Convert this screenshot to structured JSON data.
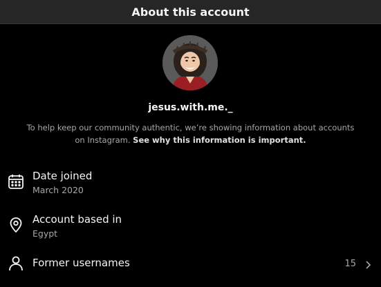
{
  "header": {
    "title": "About this account"
  },
  "profile": {
    "username": "jesus.with.me._"
  },
  "description": {
    "text": "To help keep our community authentic, we’re showing information about accounts on Instagram.",
    "link": "See why this information is important."
  },
  "rows": [
    {
      "label": "Date joined",
      "value": "March 2020",
      "icon": "calendar-icon"
    },
    {
      "label": "Account based in",
      "value": "Egypt",
      "icon": "location-pin-icon"
    },
    {
      "label": "Former usernames",
      "count": "15",
      "icon": "user-icon"
    }
  ]
}
